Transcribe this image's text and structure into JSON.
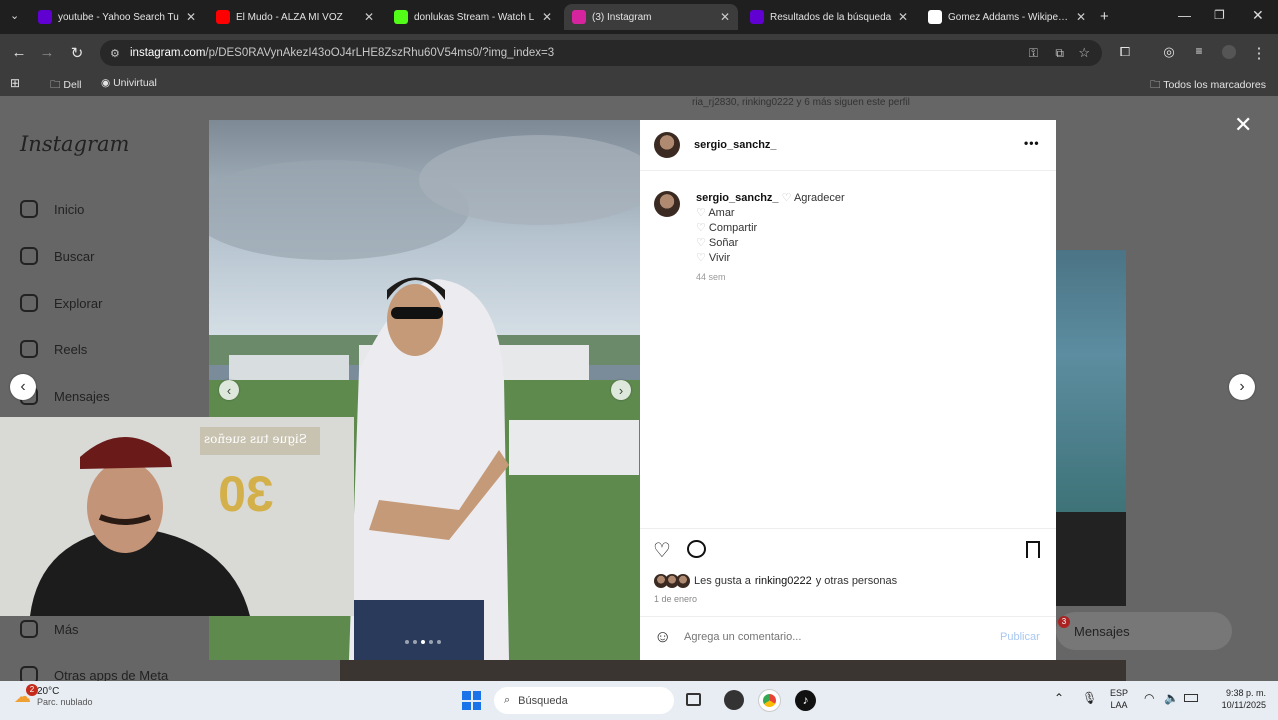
{
  "browser": {
    "tabs": [
      {
        "title": "youtube - Yahoo Search Tu",
        "favicon": "yahoo-icon",
        "color": "#6001d2",
        "active": false
      },
      {
        "title": "El Mudo - ALZA MI VOZ",
        "favicon": "youtube-icon",
        "color": "#ff0000",
        "active": false
      },
      {
        "title": "donlukas Stream - Watch L",
        "favicon": "kick-icon",
        "color": "#53fc18",
        "active": false
      },
      {
        "title": "(3) Instagram",
        "favicon": "instagram-icon",
        "color": "#d6249f",
        "active": true
      },
      {
        "title": "Resultados de la búsqueda",
        "favicon": "yahoo-icon",
        "color": "#6001d2",
        "active": false
      },
      {
        "title": "Gomez Addams - Wikipedia",
        "favicon": "wikipedia-icon",
        "color": "#ffffff",
        "active": false
      }
    ],
    "url_domain": "instagram.com",
    "url_path": "/p/DES0RAVynAkezI43oOJ4rLHE8ZszRhu60V54ms0/?img_index=3",
    "bookmarks": [
      "Dell",
      "Univirtual"
    ],
    "all_bookmarks": "Todos los marcadores"
  },
  "instagram": {
    "logo": "Instagram",
    "nav": [
      "Inicio",
      "Buscar",
      "Explorar",
      "Reels",
      "Mensajes"
    ],
    "nav_bottom": [
      "Más",
      "Otras apps de Meta"
    ],
    "followers_line": "ria_rj2830, rinking0222 y 6 más siguen este perfil",
    "messages_widget": "Mensajes",
    "messages_badge": "3"
  },
  "post": {
    "username": "sergio_sanchz_",
    "caption_first": "Agradecer",
    "caption_lines": [
      "Amar",
      "Compartir",
      "Soñar",
      "Vivir"
    ],
    "age": "44 sem",
    "likes_text": "Les gusta a",
    "likes_user": "rinking0222",
    "likes_rest": "y otras personas",
    "date": "1 de enero",
    "comment_placeholder": "Agrega un comentario...",
    "publish": "Publicar",
    "photo_count_dots": 5,
    "photo_active_dot": 3
  },
  "webcam": {
    "banner": "Sigue tus sueños",
    "number": "30"
  },
  "taskbar": {
    "weather_temp": "20°C",
    "weather_desc": "Parc. nublado",
    "weather_badge": "2",
    "search": "Búsqueda",
    "lang1": "ESP",
    "lang2": "LAA",
    "time": "9:38 p. m.",
    "date": "10/11/2025"
  }
}
